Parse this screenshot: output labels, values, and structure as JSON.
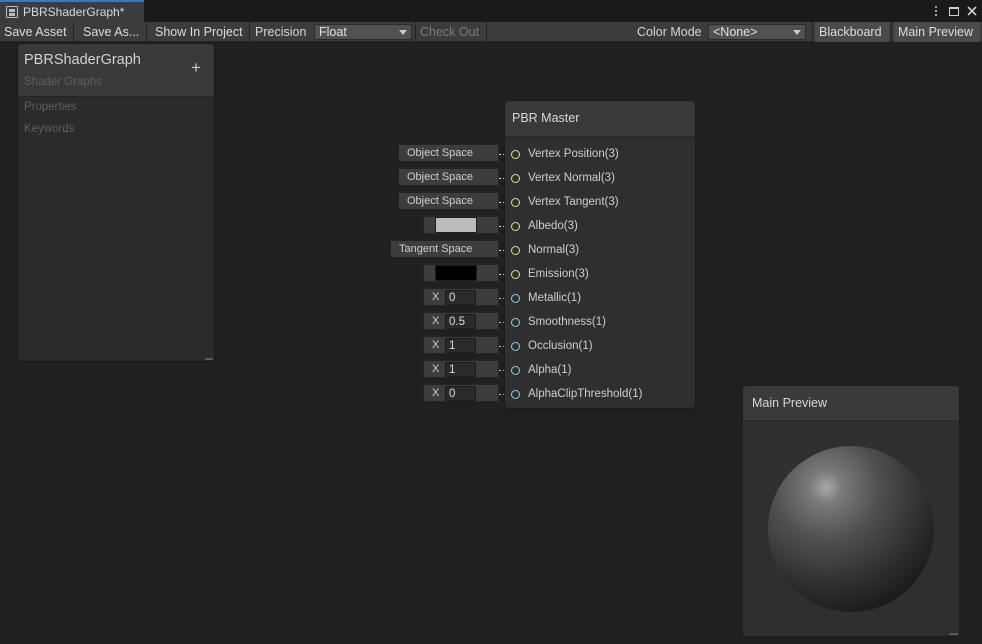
{
  "tab": {
    "title": "PBRShaderGraph*",
    "icon": "shader-graph-icon"
  },
  "window_controls": [
    "more-options-icon",
    "maximize-icon",
    "close-icon"
  ],
  "toolbar": {
    "save_asset": "Save Asset",
    "save_as": "Save As...",
    "show_in_project": "Show In Project",
    "precision_label": "Precision",
    "precision_value": "Float",
    "check_out": "Check Out",
    "color_mode_label": "Color Mode",
    "color_mode_value": "<None>",
    "blackboard": "Blackboard",
    "main_preview": "Main Preview"
  },
  "blackboard": {
    "title": "PBRShaderGraph",
    "subtitle": "Shader Graphs",
    "add_icon": "plus-icon",
    "sections": [
      "Properties",
      "Keywords"
    ]
  },
  "node": {
    "title": "PBR Master",
    "ports": [
      {
        "label": "Vertex Position(3)",
        "input_type": "space",
        "value": "Object Space",
        "color": "#e6e67e"
      },
      {
        "label": "Vertex Normal(3)",
        "input_type": "space",
        "value": "Object Space",
        "color": "#e6e67e"
      },
      {
        "label": "Vertex Tangent(3)",
        "input_type": "space",
        "value": "Object Space",
        "color": "#e6e67e"
      },
      {
        "label": "Albedo(3)",
        "input_type": "color",
        "value": "#bcbcbc",
        "color": "#e6e67e"
      },
      {
        "label": "Normal(3)",
        "input_type": "space",
        "value": "Tangent Space",
        "color": "#e6e67e"
      },
      {
        "label": "Emission(3)",
        "input_type": "color",
        "value": "#000000",
        "color": "#e6e67e"
      },
      {
        "label": "Metallic(1)",
        "input_type": "float",
        "axis": "X",
        "value": "0",
        "color": "#80d6e6"
      },
      {
        "label": "Smoothness(1)",
        "input_type": "float",
        "axis": "X",
        "value": "0.5",
        "color": "#80d6e6"
      },
      {
        "label": "Occlusion(1)",
        "input_type": "float",
        "axis": "X",
        "value": "1",
        "color": "#80d6e6"
      },
      {
        "label": "Alpha(1)",
        "input_type": "float",
        "axis": "X",
        "value": "1",
        "color": "#80d6e6"
      },
      {
        "label": "AlphaClipThreshold(1)",
        "input_type": "float",
        "axis": "X",
        "value": "0",
        "color": "#80d6e6"
      }
    ]
  },
  "preview": {
    "title": "Main Preview"
  },
  "colors": {
    "accent": "#3a79bb",
    "vector3_port": "#e6e67e",
    "vector1_port": "#80d6e6"
  }
}
